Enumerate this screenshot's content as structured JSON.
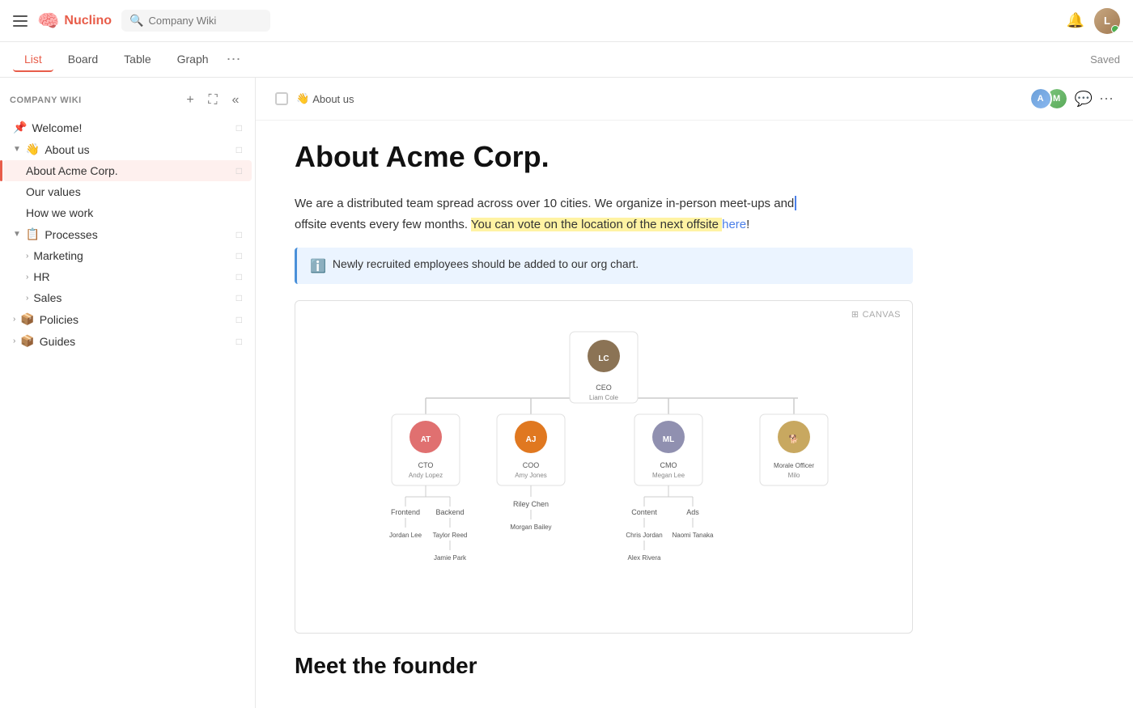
{
  "topbar": {
    "search_placeholder": "Company Wiki",
    "logo": "Nuclino",
    "saved_label": "Saved"
  },
  "nav": {
    "tabs": [
      {
        "id": "list",
        "label": "List",
        "active": true
      },
      {
        "id": "board",
        "label": "Board",
        "active": false
      },
      {
        "id": "table",
        "label": "Table",
        "active": false
      },
      {
        "id": "graph",
        "label": "Graph",
        "active": false
      }
    ]
  },
  "sidebar": {
    "title": "COMPANY WIKI",
    "items": [
      {
        "id": "welcome",
        "label": "Welcome!",
        "icon": "📌",
        "indent": 0,
        "pinned": true
      },
      {
        "id": "about-us",
        "label": "About us",
        "icon": "👋",
        "indent": 0,
        "expanded": true
      },
      {
        "id": "about-acme",
        "label": "About Acme Corp.",
        "indent": 1,
        "active": true
      },
      {
        "id": "our-values",
        "label": "Our values",
        "indent": 1
      },
      {
        "id": "how-we-work",
        "label": "How we work",
        "indent": 1
      },
      {
        "id": "processes",
        "label": "Processes",
        "icon": "📋",
        "indent": 0,
        "expanded": true
      },
      {
        "id": "marketing",
        "label": "Marketing",
        "indent": 1,
        "hasChildren": true
      },
      {
        "id": "hr",
        "label": "HR",
        "indent": 1,
        "hasChildren": true
      },
      {
        "id": "sales",
        "label": "Sales",
        "indent": 1,
        "hasChildren": true
      },
      {
        "id": "policies",
        "label": "Policies",
        "icon": "📦",
        "indent": 0,
        "hasChildren": true
      },
      {
        "id": "guides",
        "label": "Guides",
        "icon": "📦",
        "indent": 0,
        "hasChildren": true
      }
    ]
  },
  "content": {
    "breadcrumb": "About us",
    "breadcrumb_icon": "👋",
    "title": "About Acme Corp.",
    "paragraph1": "We are a distributed team spread across over 10 cities. We organize in-person meet-ups and offsite events every few months.",
    "paragraph1_link_text": "here",
    "paragraph1_after": "!",
    "paragraph1_before_link": "You can vote on the location of the next offsite ",
    "info_text": "Newly recruited employees should be added to our org chart.",
    "canvas_label": "CANVAS",
    "org": {
      "ceo": {
        "title": "CEO",
        "name": "Liam Cole"
      },
      "cto": {
        "title": "CTO",
        "name": "Andy Lopez"
      },
      "coo": {
        "title": "COO",
        "name": "Amy Jones"
      },
      "cmo": {
        "title": "CMO",
        "name": "Megan Lee"
      },
      "morale": {
        "title": "Morale Officer",
        "name": "Milo"
      },
      "frontend": {
        "title": "Frontend"
      },
      "backend": {
        "title": "Backend"
      },
      "riley": {
        "title": "Riley Chen"
      },
      "content": {
        "title": "Content"
      },
      "ads": {
        "title": "Ads"
      },
      "jordan": {
        "title": "Jordan Lee"
      },
      "taylor": {
        "title": "Taylor Reed"
      },
      "morgan": {
        "title": "Morgan Bailey"
      },
      "chris": {
        "title": "Chris Jordan"
      },
      "naomi": {
        "title": "Naomi Tanaka"
      },
      "jamie": {
        "title": "Jamie Park"
      },
      "alex": {
        "title": "Alex Rivera"
      }
    },
    "meet_founder_title": "Meet the founder"
  }
}
